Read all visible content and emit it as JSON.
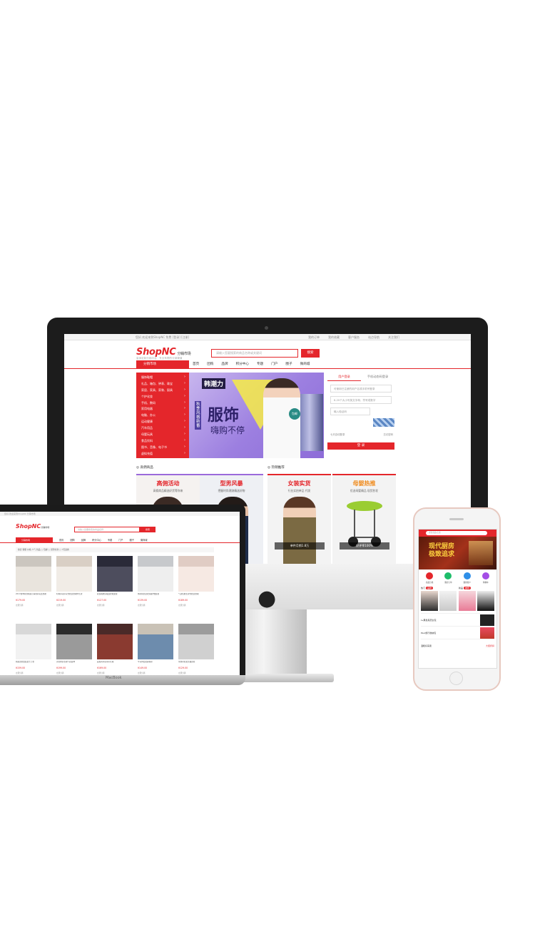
{
  "desktop": {
    "top_left": "您好,欢迎来到ShopNC 免费 [登录] [注册]",
    "top_links": [
      "我的订单",
      "我的收藏",
      "客户服务",
      "站点导航",
      "关注我们"
    ],
    "logo": "ShopNC",
    "logo_suffix": "分销市场",
    "logo_sub": "量身定制分销平台 · 专业有限的分销渠道",
    "search_placeholder": "请输入您要搜索的商品名称或关键词",
    "search_button": "搜索",
    "category_title": "分销市场",
    "nav": [
      "首页",
      "团购",
      "品牌",
      "积分中心",
      "专题",
      "门户",
      "圈子",
      "微商城"
    ],
    "categories": [
      "服饰鞋帽",
      "礼品、箱包、钟表、珠宝",
      "家居、家具、家装、厨具",
      "个护化妆",
      "手机、数码",
      "家用电器",
      "电脑、办公",
      "运动健康",
      "汽车用品",
      "母婴玩具",
      "食品饮料",
      "图书、音像、电子书",
      "虚拟充值"
    ],
    "banner": {
      "label": "韩潮力",
      "vertical": "秋季风格新番",
      "title": "服饰",
      "subtitle": "嗨购不停",
      "badge": "包邮"
    },
    "login": {
      "tab_member": "用户登录",
      "tab_mobile": "手机动态码登录",
      "account_placeholder": "可使用已注册的用户名或手机号登录",
      "password_placeholder": "6-20个大小写英文字母、符号或数字",
      "captcha_placeholder": "输入验证码",
      "remember": "七天自动登录",
      "forgot": "忘记密码",
      "button": "登 录"
    },
    "sections": {
      "left": "高佣商品",
      "right": "热销推荐"
    },
    "promos": [
      {
        "title": "高佣活动",
        "sub": "高佣商品精选好货等你来",
        "color": "#e4262b"
      },
      {
        "title": "型男风暴",
        "sub": "把握时尚潮流精选好物",
        "color": "#e4262b"
      },
      {
        "title": "女装实货",
        "sub": "行业实拍单品 代发",
        "color": "#e4262b",
        "label": "单件月销1.8万"
      },
      {
        "title": "母婴热推",
        "sub": "优选母婴精品 现货秒发",
        "color": "#f08c1f",
        "label": "好评率100%"
      }
    ]
  },
  "laptop": {
    "top": "您好,欢迎来到ShopNC 分销市场",
    "logo": "ShopNC",
    "logo_suffix": "分销市场",
    "search_placeholder": "请输入您要搜索的商品名称",
    "search_button": "搜索",
    "category_title": "分销市场",
    "nav": [
      "首页",
      "团购",
      "品牌",
      "积分中心",
      "专题",
      "门户",
      "圈子",
      "微商城"
    ],
    "filter": "综合  销量  价格  人气  新品  □ 包邮  □ 货到付款  □ 7天退换",
    "label": "MacBook",
    "products": [
      {
        "title": "2017夏季新款韩版小清新碎花连衣裙",
        "price": "¥179.00",
        "action": "立即分销"
      },
      {
        "title": "时尚碎花印花雪纺连衣裙中长款",
        "price": "¥219.00",
        "action": "立即分销"
      },
      {
        "title": "复古格纹短袖连衣裙女夏",
        "price": "¥127.00",
        "action": "立即分销"
      },
      {
        "title": "休闲纯色宽松短袖T恤女夏",
        "price": "¥139.00",
        "action": "立即分销"
      },
      {
        "title": "气质优雅长款雪纺连衣裙",
        "price": "¥189.00",
        "action": "立即分销"
      },
      {
        "title": "韩版宽松套装女士上衣",
        "price": "¥159.00",
        "action": "立即分销"
      },
      {
        "title": "黑色修身长裙气质女神",
        "price": "¥199.00",
        "action": "立即分销"
      },
      {
        "title": "民族风印花吊带长裙",
        "price": "¥169.00",
        "action": "立即分销"
      },
      {
        "title": "牛仔外套女春秋款",
        "price": "¥149.00",
        "action": "立即分销"
      },
      {
        "title": "条纹衬衫女长袖宽松",
        "price": "¥129.00",
        "action": "立即分销"
      }
    ]
  },
  "phone": {
    "search_placeholder": "搜索商品/店铺",
    "banner_title": "现代厨房",
    "banner_sub": "极致追求",
    "icons": [
      "商品分类",
      "我的订单",
      "我的账户",
      "购物车"
    ],
    "section_left": "热门",
    "section_left_tag": "品牌",
    "section_right": "新品",
    "section_right_tag": "推荐",
    "items": [
      {
        "name": "Lv黑色真皮女包",
        "note": "女包"
      },
      {
        "name": "Paul旅行收纳包",
        "note": "收纳"
      },
      {
        "name": "温暖好来卖",
        "note": "大促折扣"
      }
    ]
  },
  "colors": {
    "brand_red": "#e4262b",
    "mom_orange": "#f08c1f"
  }
}
